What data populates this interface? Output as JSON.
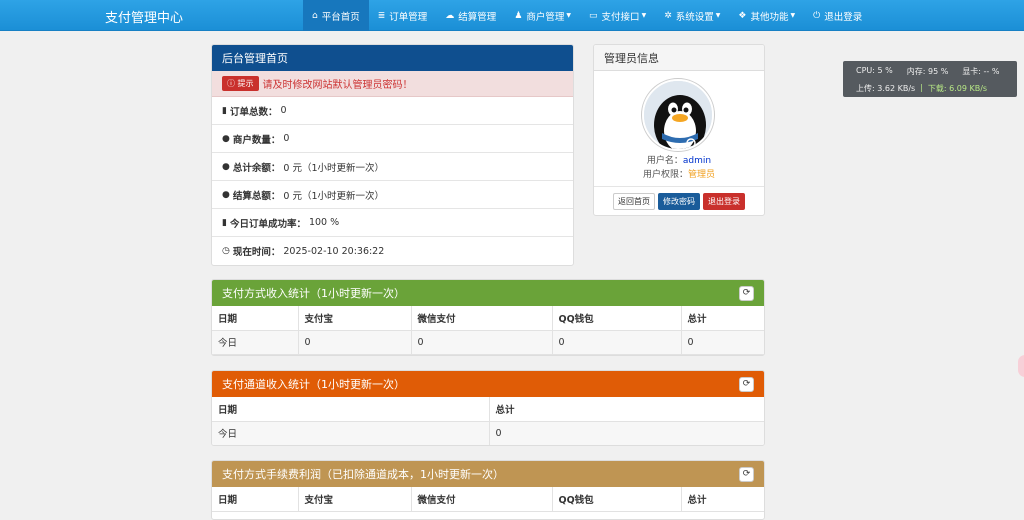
{
  "brand": "支付管理中心",
  "nav": [
    {
      "icon": "home-icon",
      "glyph": "⌂",
      "label": "平台首页",
      "caret": false,
      "active": true
    },
    {
      "icon": "list-icon",
      "glyph": "≣",
      "label": "订单管理",
      "caret": false,
      "active": false
    },
    {
      "icon": "cloud-icon",
      "glyph": "☁",
      "label": "结算管理",
      "caret": false,
      "active": false
    },
    {
      "icon": "user-icon",
      "glyph": "♟",
      "label": "商户管理",
      "caret": true,
      "active": false
    },
    {
      "icon": "credit-card-icon",
      "glyph": "▭",
      "label": "支付接口",
      "caret": true,
      "active": false
    },
    {
      "icon": "gear-icon",
      "glyph": "✲",
      "label": "系统设置",
      "caret": true,
      "active": false
    },
    {
      "icon": "cube-icon",
      "glyph": "❖",
      "label": "其他功能",
      "caret": true,
      "active": false
    },
    {
      "icon": "power-icon",
      "glyph": "⏻",
      "label": "退出登录",
      "caret": false,
      "active": false
    }
  ],
  "admin_home": {
    "title": "后台管理首页",
    "alert_badge": "提示",
    "alert_text": "请及时修改网站默认管理员密码！",
    "rows": [
      {
        "icon": "bar-chart-icon",
        "glyph": "▮",
        "label": "订单总数：",
        "value": "0"
      },
      {
        "icon": "drop-icon",
        "glyph": "●",
        "label": "商户数量：",
        "value": "0"
      },
      {
        "icon": "drop-icon",
        "glyph": "●",
        "label": "总计余额：",
        "value": "0 元（1小时更新一次）"
      },
      {
        "icon": "drop-icon",
        "glyph": "●",
        "label": "结算总额：",
        "value": "0 元（1小时更新一次）"
      },
      {
        "icon": "bar-chart-icon",
        "glyph": "▮",
        "label": "今日订单成功率：",
        "value": "100 %"
      },
      {
        "icon": "clock-icon",
        "glyph": "◷",
        "label": "现在时间：",
        "value": "2025-02-10 20:36:22"
      }
    ]
  },
  "admin_info": {
    "title": "管理员信息",
    "username_label": "用户名：",
    "username": "admin",
    "role_label": "用户权限：",
    "role": "管理员",
    "buttons": [
      "返回首页",
      "修改密码",
      "退出登录"
    ]
  },
  "pay_method_income": {
    "title": "支付方式收入统计（1小时更新一次）",
    "headers": [
      "日期",
      "支付宝",
      "微信支付",
      "QQ钱包",
      "总计"
    ],
    "rows": [
      [
        "今日",
        "0",
        "0",
        "0",
        "0"
      ]
    ]
  },
  "channel_income": {
    "title": "支付通道收入统计（1小时更新一次）",
    "headers": [
      "日期",
      "总计"
    ],
    "rows": [
      [
        "今日",
        "0"
      ]
    ]
  },
  "fee_profit": {
    "title": "支付方式手续费利润（已扣除通道成本，1小时更新一次）",
    "headers": [
      "日期",
      "支付宝",
      "微信支付",
      "QQ钱包",
      "总计"
    ]
  },
  "monitor": {
    "cpu": "CPU: 5 %",
    "mem": "内存: 95 %",
    "gpu": "显卡: -- %",
    "up": "上传: 3.62 KB/s",
    "sep": "|",
    "down": "下载: 6.09 KB/s"
  }
}
